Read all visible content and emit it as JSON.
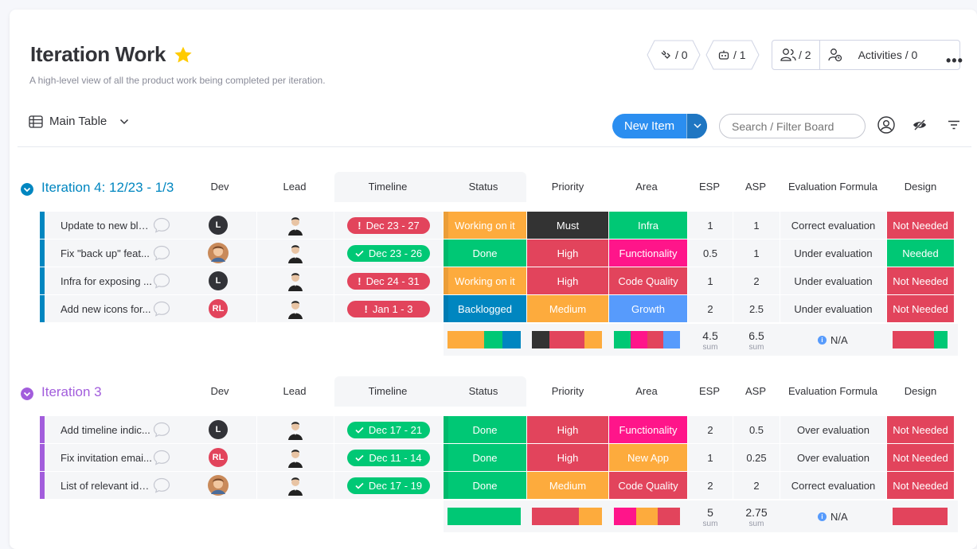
{
  "board": {
    "title": "Iteration Work",
    "subtitle": "A high-level view of all the product work being completed per iteration.",
    "integrations": "/ 0",
    "automations": "/ 1",
    "members": "/ 2",
    "activities": "Activities / 0"
  },
  "toolbar": {
    "view_label": "Main Table",
    "new_item_label": "New Item",
    "search_placeholder": "Search / Filter Board"
  },
  "columns": {
    "dev": "Dev",
    "lead": "Lead",
    "timeline": "Timeline",
    "status": "Status",
    "priority": "Priority",
    "area": "Area",
    "esp": "ESP",
    "asp": "ASP",
    "eval": "Evaluation Formula",
    "design": "Design"
  },
  "colors": {
    "working": "#fdab3d",
    "done": "#00c875",
    "stuck": "#e2445c",
    "backlogged": "#0086c0",
    "must": "#333333",
    "high": "#e2445c",
    "medium": "#fdab3d",
    "infra": "#00c875",
    "functionality": "#ff158a",
    "code_quality": "#e2445c",
    "growth": "#579bfc",
    "new_app": "#fdab3d",
    "needed": "#00c875",
    "not_needed": "#e2445c",
    "group4": "#0086c0",
    "group3": "#a25ddc"
  },
  "groups": [
    {
      "title": "Iteration 4: 12/23 - 1/3",
      "rows": [
        {
          "name": "Update to new blu...",
          "dev": "L",
          "timeline": "Dec 23 - 27",
          "overdue": true,
          "status": "Working on it",
          "priority": "Must",
          "area": "Infra",
          "esp": "1",
          "asp": "1",
          "eval": "Correct evaluation",
          "design": "Not Needed"
        },
        {
          "name": "Fix \"back up\" feat...",
          "dev": "",
          "timeline": "Dec 23 - 26",
          "overdue": false,
          "status": "Done",
          "priority": "High",
          "area": "Functionality",
          "esp": "0.5",
          "asp": "1",
          "eval": "Under evaluation",
          "design": "Needed"
        },
        {
          "name": "Infra for exposing ...",
          "dev": "L",
          "timeline": "Dec 24 - 31",
          "overdue": true,
          "status": "Working on it",
          "priority": "High",
          "area": "Code Quality",
          "esp": "1",
          "asp": "2",
          "eval": "Under evaluation",
          "design": "Not Needed"
        },
        {
          "name": "Add new icons for...",
          "dev": "RL",
          "timeline": "Jan 1 - 3",
          "overdue": true,
          "status": "Backlogged",
          "priority": "Medium",
          "area": "Growth",
          "esp": "2",
          "asp": "2.5",
          "eval": "Under evaluation",
          "design": "Not Needed"
        }
      ],
      "summary": {
        "esp": "4.5",
        "asp": "6.5",
        "sum_label": "sum",
        "eval": "N/A"
      }
    },
    {
      "title": "Iteration 3",
      "rows": [
        {
          "name": "Add timeline indic...",
          "dev": "L",
          "timeline": "Dec 17 - 21",
          "overdue": false,
          "status": "Done",
          "priority": "High",
          "area": "Functionality",
          "esp": "2",
          "asp": "0.5",
          "eval": "Over evaluation",
          "design": "Not Needed"
        },
        {
          "name": "Fix invitation emai...",
          "dev": "RL",
          "timeline": "Dec 11 - 14",
          "overdue": false,
          "status": "Done",
          "priority": "High",
          "area": "New App",
          "esp": "1",
          "asp": "0.25",
          "eval": "Over evaluation",
          "design": "Not Needed"
        },
        {
          "name": "List of relevant ids...",
          "dev": "",
          "timeline": "Dec 17 - 19",
          "overdue": false,
          "status": "Done",
          "priority": "Medium",
          "area": "Code Quality",
          "esp": "2",
          "asp": "2",
          "eval": "Correct evaluation",
          "design": "Not Needed"
        }
      ],
      "summary": {
        "esp": "5",
        "asp": "2.75",
        "sum_label": "sum",
        "eval": "N/A"
      }
    }
  ]
}
